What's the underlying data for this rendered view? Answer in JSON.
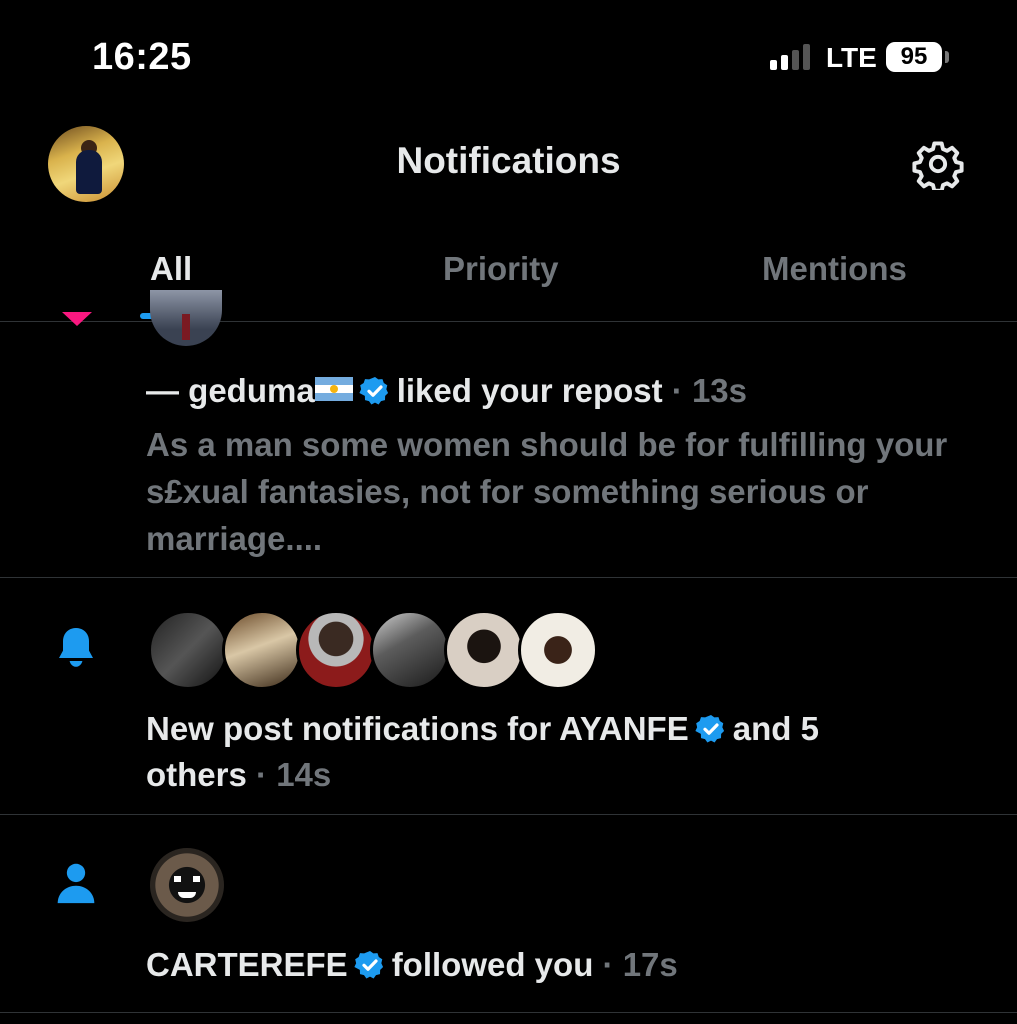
{
  "status_bar": {
    "time": "16:25",
    "network": "LTE",
    "battery": "95"
  },
  "header": {
    "title": "Notifications",
    "settings_icon": "gear-icon"
  },
  "tabs": [
    {
      "label": "All",
      "active": true
    },
    {
      "label": "Priority",
      "active": false
    },
    {
      "label": "Mentions",
      "active": false
    }
  ],
  "notifications": [
    {
      "type_icon": "heart-icon",
      "name": "— geduma",
      "action": "liked your repost",
      "separator": "·",
      "time": "13s",
      "body": "As a man some women should be for fulfilling your s£xual fantasies, not for something serious or marriage...."
    },
    {
      "type_icon": "bell-icon",
      "text_before": "New post notifications for AYANFE",
      "text_after": "and 5",
      "text_line2": "others",
      "separator": "·",
      "time": "14s"
    },
    {
      "type_icon": "person-icon",
      "name": "CARTEREFE",
      "action": "followed you",
      "separator": "·",
      "time": "17s"
    }
  ],
  "colors": {
    "accent": "#1d9bf0",
    "background": "#000000",
    "text": "#e7e9ea",
    "muted": "#71767b",
    "like": "#f91880"
  }
}
